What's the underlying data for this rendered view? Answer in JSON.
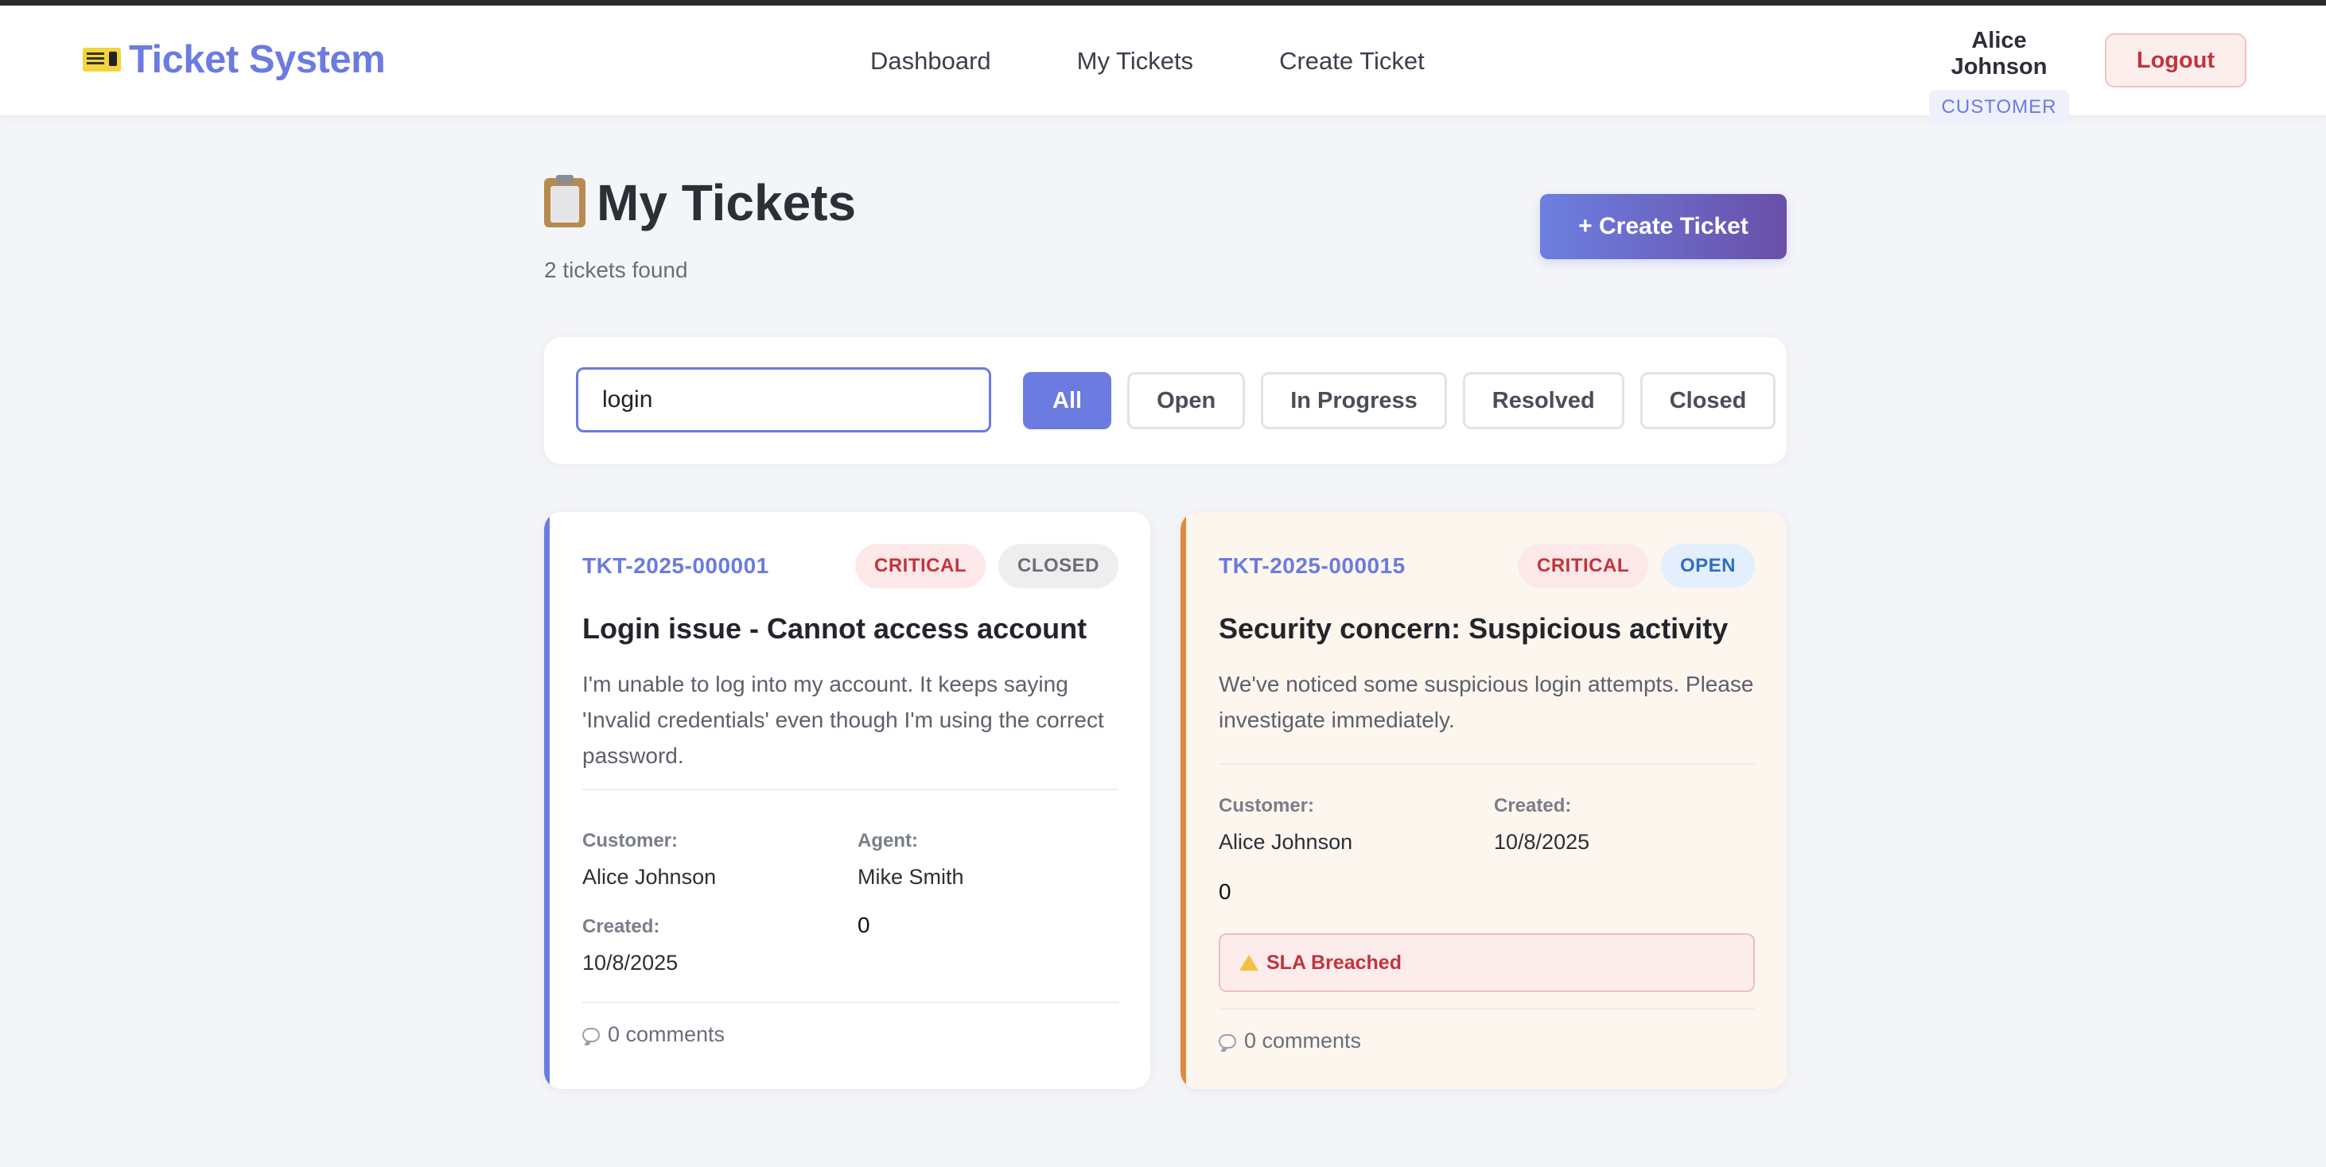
{
  "header": {
    "brand": "Ticket System",
    "nav": [
      "Dashboard",
      "My Tickets",
      "Create Ticket"
    ],
    "user_name": "Alice Johnson",
    "user_role": "CUSTOMER",
    "logout_label": "Logout"
  },
  "page": {
    "title": "My Tickets",
    "subtitle": "2 tickets found",
    "create_label": "+ Create Ticket"
  },
  "filters": {
    "search_value": "login",
    "buttons": [
      "All",
      "Open",
      "In Progress",
      "Resolved",
      "Closed"
    ],
    "active": "All"
  },
  "tickets": [
    {
      "id": "TKT-2025-000001",
      "priority": "CRITICAL",
      "status": "CLOSED",
      "title": "Login issue - Cannot access account",
      "description": "I'm unable to log into my account. It keeps saying 'Invalid credentials' even though I'm using the correct password.",
      "customer_label": "Customer:",
      "customer": "Alice Johnson",
      "agent_label": "Agent:",
      "agent": "Mike Smith",
      "created_label": "Created:",
      "created": "10/8/2025",
      "extra": "0",
      "comments": "0 comments",
      "accent_color": "#6b7be0"
    },
    {
      "id": "TKT-2025-000015",
      "priority": "CRITICAL",
      "status": "OPEN",
      "title": "Security concern: Suspicious activity",
      "description": "We've noticed some suspicious login attempts. Please investigate immediately.",
      "customer_label": "Customer:",
      "customer": "Alice Johnson",
      "created_label": "Created:",
      "created": "10/8/2025",
      "extra": "0",
      "sla": "SLA Breached",
      "comments": "0 comments",
      "accent_color": "#e08a3c"
    }
  ],
  "colors": {
    "primary": "#6b7be0",
    "critical": "#c2343c",
    "open": "#2f6fc0"
  }
}
